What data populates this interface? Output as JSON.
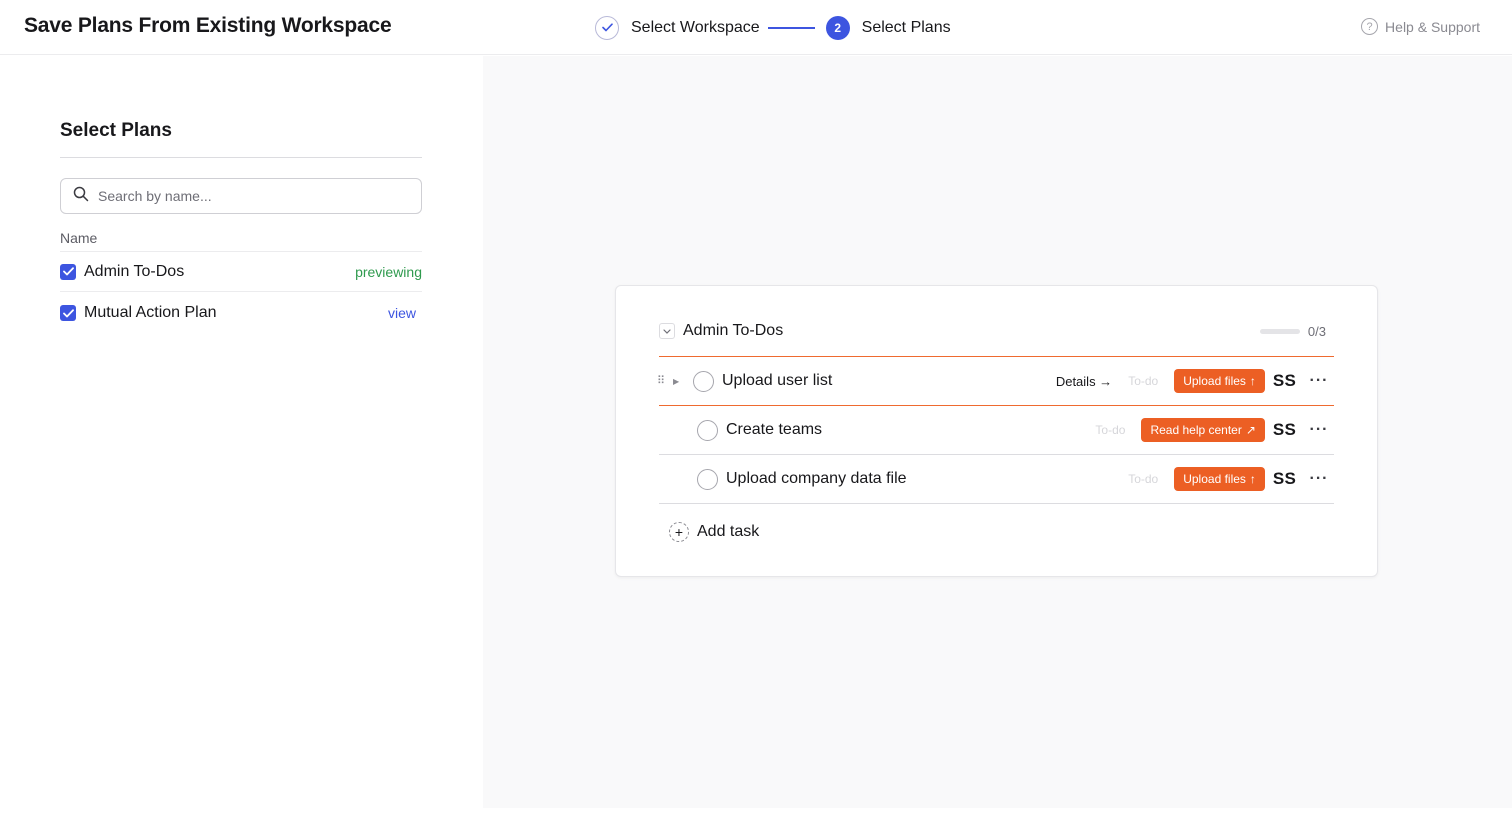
{
  "header": {
    "title": "Save Plans From Existing Workspace",
    "steps": [
      {
        "label": "Select Workspace",
        "state": "done"
      },
      {
        "number": "2",
        "label": "Select Plans",
        "state": "active"
      }
    ],
    "help_label": "Help & Support"
  },
  "sidebar": {
    "title": "Select Plans",
    "search_placeholder": "Search by name...",
    "column_header": "Name",
    "plans": [
      {
        "name": "Admin To-Dos",
        "status": "previewing",
        "checked": true
      },
      {
        "name": "Mutual Action Plan",
        "status": "view",
        "checked": true
      }
    ]
  },
  "preview": {
    "plan_title": "Admin To-Dos",
    "progress": "0/3",
    "progress_fraction": 0,
    "tasks": [
      {
        "name": "Upload user list",
        "details": "Details →",
        "status": "To-do",
        "action": "Upload files",
        "action_icon": "arrow-up-icon",
        "assignee": "SS",
        "more": "···"
      },
      {
        "name": "Create teams",
        "status": "To-do",
        "action": "Read help center",
        "action_icon": "arrow-up-right-icon",
        "assignee": "SS",
        "more": "···"
      },
      {
        "name": "Upload company data file",
        "status": "To-do",
        "action": "Upload files",
        "action_icon": "arrow-up-icon",
        "assignee": "SS",
        "more": "···"
      }
    ],
    "add_task_label": "Add task"
  },
  "colors": {
    "accent": "#3d55e0",
    "action": "#ec5f24",
    "previewing": "#2f9a4e"
  }
}
